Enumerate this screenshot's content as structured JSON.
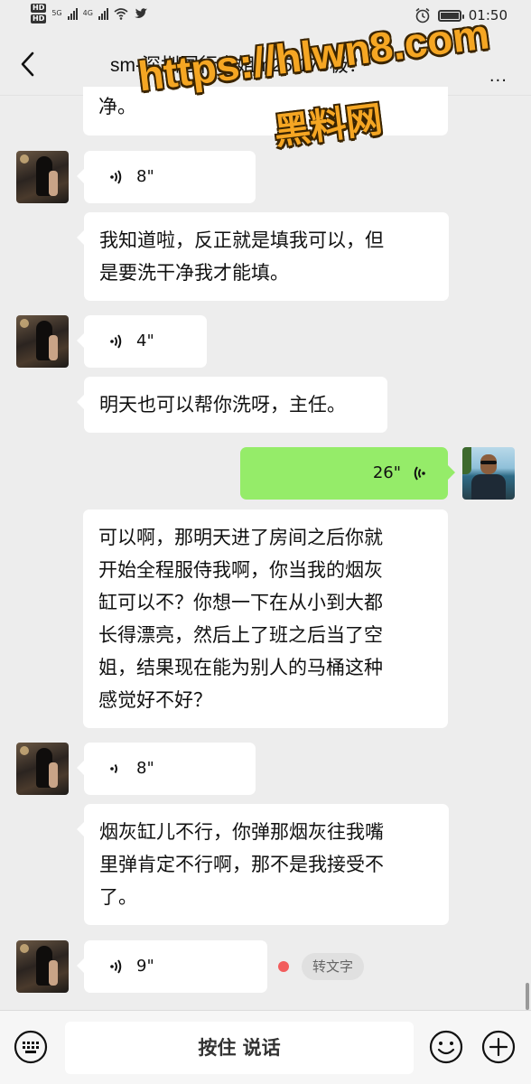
{
  "status_bar": {
    "hd1": "HD",
    "hd2": "HD",
    "net1": "5G",
    "net2": "4G",
    "time": "01:50"
  },
  "nav": {
    "title": "sm-深圳国行空姐m25/173极？",
    "more": "..."
  },
  "watermark": {
    "url": "https://hlwn8.com",
    "name": "黑料网"
  },
  "messages": [
    {
      "type": "text",
      "from": "her",
      "text": "净。"
    },
    {
      "type": "voice",
      "from": "her",
      "duration": "8\""
    },
    {
      "type": "text",
      "from": "her",
      "lines": [
        "我知道啦，反正就是填我可以，但",
        "是要洗干净我才能填。"
      ]
    },
    {
      "type": "voice",
      "from": "her",
      "duration": "4\""
    },
    {
      "type": "text",
      "from": "her",
      "lines": [
        "明天也可以帮你洗呀，主任。"
      ]
    },
    {
      "type": "voice",
      "from": "me",
      "duration": "26\""
    },
    {
      "type": "text",
      "from": "her",
      "lines": [
        "可以啊，那明天进了房间之后你就",
        "开始全程服侍我啊，你当我的烟灰",
        "缸可以不？你想一下在从小到大都",
        "长得漂亮，然后上了班之后当了空",
        "姐，结果现在能为别人的马桶这种",
        "感觉好不好？"
      ]
    },
    {
      "type": "voice",
      "from": "her",
      "duration": "8\""
    },
    {
      "type": "text",
      "from": "her",
      "lines": [
        "烟灰缸儿不行，你弹那烟灰往我嘴",
        "里弹肯定不行啊，那不是我接受不",
        "了。"
      ]
    },
    {
      "type": "voice",
      "from": "her",
      "duration": "9\"",
      "transcribe_label": "转文字"
    }
  ],
  "input": {
    "hold_to_talk": "按住 说话"
  },
  "colors": {
    "background": "#ededed",
    "my_bubble": "#95ec69",
    "their_bubble": "#ffffff",
    "unread_dot": "#f25d5d",
    "watermark": "#f5a623"
  },
  "icons": [
    "back-arrow-icon",
    "voice-wave-icon",
    "keyboard-icon",
    "emoji-icon",
    "plus-icon",
    "alarm-icon",
    "wifi-icon",
    "twitter-icon",
    "battery-icon"
  ]
}
